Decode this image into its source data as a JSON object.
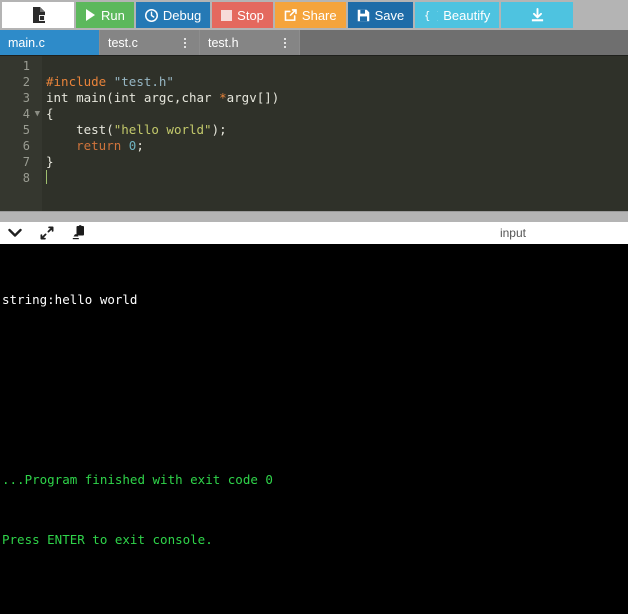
{
  "toolbar": {
    "file_button_title": "New File",
    "buttons": [
      {
        "id": "file",
        "label": "",
        "icon": "file-icon"
      },
      {
        "id": "run",
        "label": "Run",
        "icon": "play-icon"
      },
      {
        "id": "debug",
        "label": "Debug",
        "icon": "debug-circle-icon"
      },
      {
        "id": "stop",
        "label": "Stop",
        "icon": "stop-square-icon"
      },
      {
        "id": "share",
        "label": "Share",
        "icon": "share-icon"
      },
      {
        "id": "save",
        "label": "Save",
        "icon": "floppy-disk-icon"
      },
      {
        "id": "beautify",
        "label": "Beautify",
        "icon": "braces-icon"
      },
      {
        "id": "download",
        "label": "",
        "icon": "download-icon"
      }
    ]
  },
  "tabs": {
    "items": [
      {
        "label": "main.c",
        "active": true,
        "has_menu": false
      },
      {
        "label": "test.c",
        "active": false,
        "has_menu": true
      },
      {
        "label": "test.h",
        "active": false,
        "has_menu": true
      }
    ]
  },
  "editor": {
    "language": "c",
    "line_numbers": [
      "1",
      "2",
      "3",
      "4",
      "5",
      "6",
      "7",
      "8"
    ],
    "fold_marker_line": "4",
    "cursor_line": "8",
    "lines": [
      {
        "n": "1",
        "text": ""
      },
      {
        "n": "2",
        "text": "#include \"test.h\""
      },
      {
        "n": "3",
        "text": "int main(int argc,char *argv[])"
      },
      {
        "n": "4",
        "text": "{"
      },
      {
        "n": "5",
        "text": "    test(\"hello world\");"
      },
      {
        "n": "6",
        "text": "    return 0;"
      },
      {
        "n": "7",
        "text": "}"
      },
      {
        "n": "8",
        "text": ""
      }
    ],
    "tokens": {
      "l2_directive": "#include",
      "l2_header": "\"test.h\"",
      "l3_a": "int main(int argc,char ",
      "l3_star": "*",
      "l3_b": "argv[])",
      "l4": "{",
      "l5_a": "    test(",
      "l5_str": "\"hello world\"",
      "l5_b": ");",
      "l6_kw": "    return ",
      "l6_num": "0",
      "l6_semi": ";",
      "l7": "}"
    }
  },
  "console_header": {
    "icons": [
      {
        "id": "collapse",
        "name": "chevron-down-icon"
      },
      {
        "id": "expand",
        "name": "expand-arrows-icon"
      },
      {
        "id": "clear",
        "name": "clear-console-icon"
      }
    ],
    "input_label": "input"
  },
  "console": {
    "lines": [
      {
        "text": "string:hello world",
        "color": "white"
      },
      {
        "text": "",
        "color": "white"
      },
      {
        "text": "",
        "color": "white"
      },
      {
        "text": "...Program finished with exit code 0",
        "color": "green"
      },
      {
        "text": "Press ENTER to exit console.",
        "color": "green"
      }
    ]
  },
  "colors": {
    "run": "#5cb85c",
    "debug": "#2579b5",
    "stop": "#e4695e",
    "share": "#f5a43c",
    "save": "#1e6ca8",
    "beautify": "#4ec3e0",
    "download": "#4ec3e0",
    "tab_active": "#2e8bc9",
    "editor_bg": "#2f3129",
    "console_bg": "#000000",
    "console_green": "#2fd44a"
  }
}
